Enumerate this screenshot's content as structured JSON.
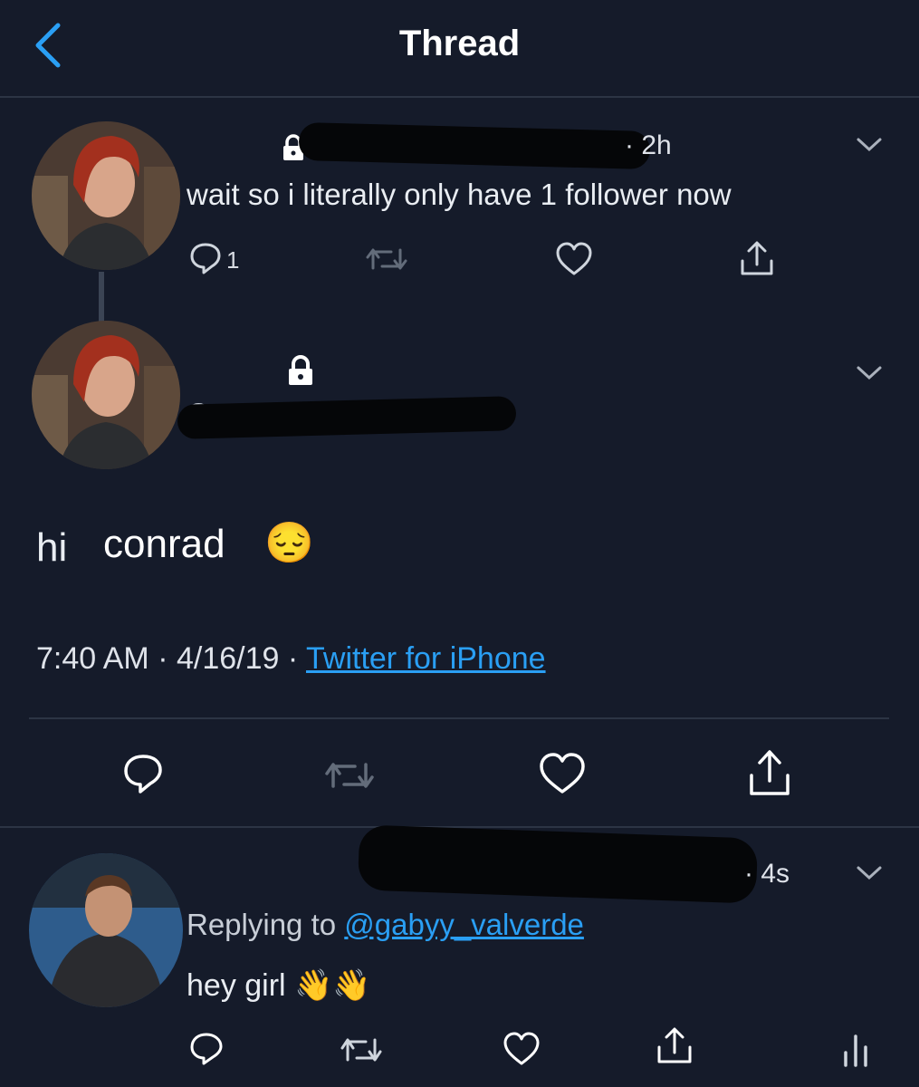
{
  "header": {
    "title": "Thread"
  },
  "tweet1": {
    "time": "· 2h",
    "text": "wait so i literally only have 1 follower now",
    "reply_count": "1"
  },
  "tweet2": {
    "handle_partial": "@g",
    "text_hi": "hi",
    "text_name": "conrad",
    "emoji": "😔",
    "timestamp": "7:40 AM · 4/16/19 · ",
    "source": "Twitter for iPhone"
  },
  "tweet3": {
    "time": "· 4s",
    "replying_prefix": "Replying to ",
    "replying_handle": "@gabyy_valverde",
    "text": "hey girl",
    "emoji": "👋👋"
  },
  "colors": {
    "background": "#151b2a",
    "link": "#2a9ff4",
    "redaction": "#050608"
  }
}
